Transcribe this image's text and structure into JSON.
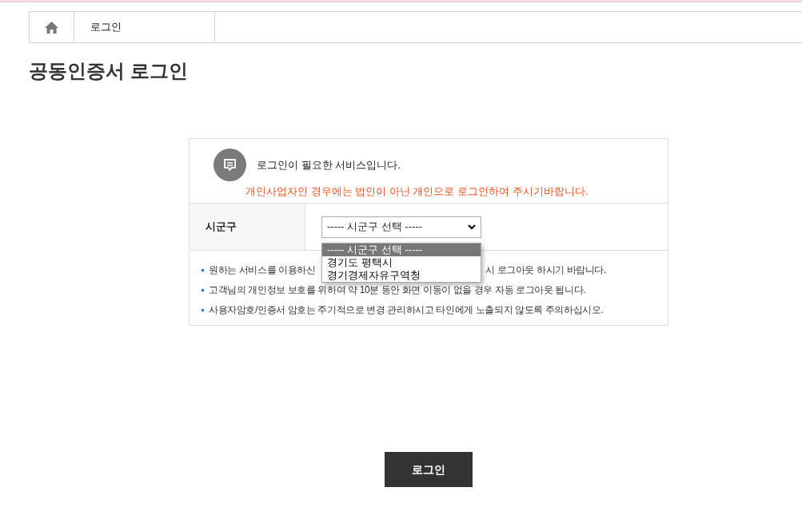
{
  "breadcrumb": {
    "current": "로그인"
  },
  "title": "공동인증서 로그인",
  "notice": {
    "message": "로그인이 필요한 서비스입니다.",
    "warning": "개인사업자인 경우에는 법인이 아닌 개인으로 로그인하여 주시기바랍니다."
  },
  "form": {
    "label": "시군구",
    "select": {
      "value": "----- 시군구 선택 -----",
      "expanded": true,
      "options": [
        {
          "label": "----- 시군구 선택 -----",
          "selected": true
        },
        {
          "label": "경기도 평택시",
          "selected": false
        },
        {
          "label": "경기경제자유구역청",
          "selected": false
        }
      ]
    }
  },
  "notes": [
    {
      "parts": [
        "원하는 서비스를 이용하신",
        "시 로그아웃 하시기 바랍니다."
      ]
    },
    {
      "parts": [
        "고객님의 개인정보 보호를 위하여 약 10분 동안 화면 이동이 없을 경우 자동 로그아웃 됩니다."
      ]
    },
    {
      "parts": [
        "사용자암호/인증서 암호는 주기적으로 변경 관리하시고 타인에게 노출되지 않도록 주의하십시오."
      ]
    }
  ],
  "login_button": "로그인"
}
